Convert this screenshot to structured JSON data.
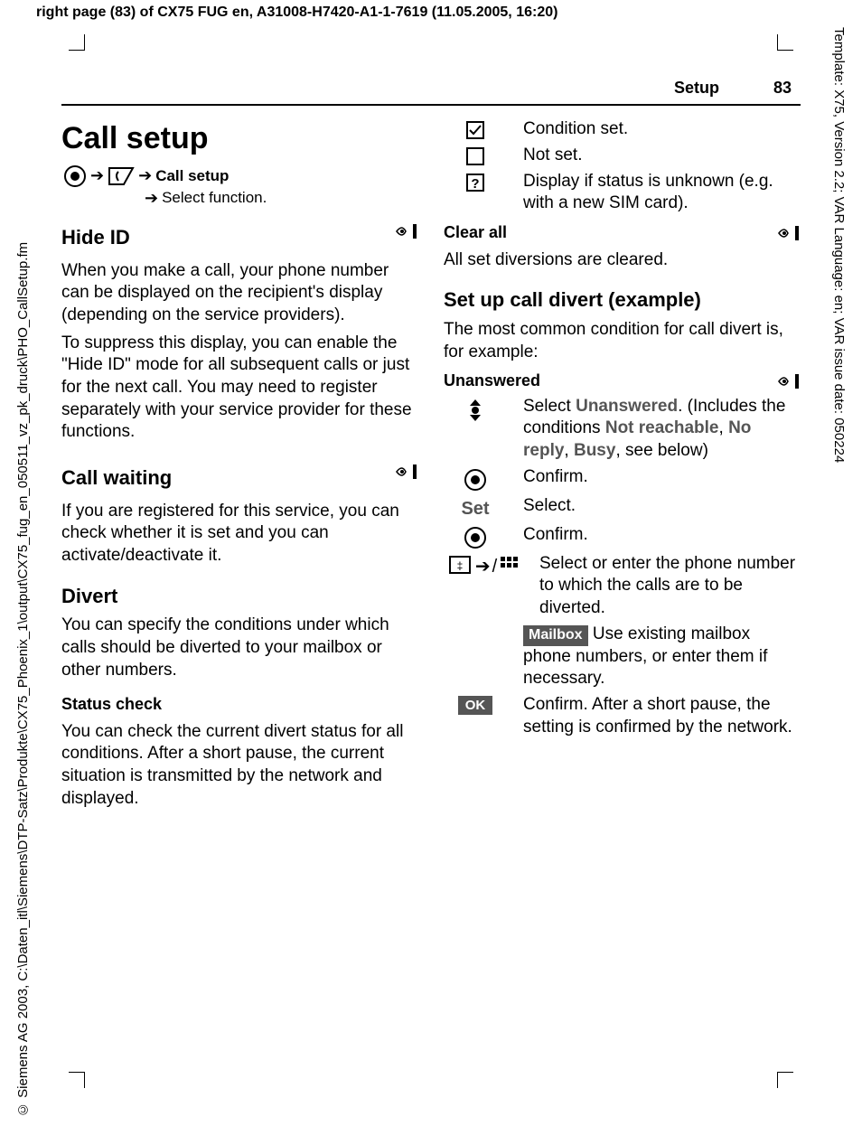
{
  "meta": {
    "top": "right page (83) of CX75 FUG en, A31008-H7420-A1-1-7619 (11.05.2005, 16:20)",
    "left": "© Siemens AG 2003, C:\\Daten_itl\\Siemens\\DTP-Satz\\Produkte\\CX75_Phoenix_1\\output\\CX75_fug_en_050511_vz_pk_druck\\PHO_CallSetup.fm",
    "right": "Template: X75, Version 2.2; VAR Language: en; VAR issue date: 050224"
  },
  "header": {
    "section": "Setup",
    "page": "83"
  },
  "left_col": {
    "title": "Call setup",
    "crumb1": "Call setup",
    "crumb2": "Select function.",
    "hide_id": {
      "h": "Hide ID",
      "p1": "When you make a call, your phone number can be displayed on the recipient's display (depending on the service providers).",
      "p2": "To suppress this display, you can enable the \"Hide ID\" mode for all subsequent calls or just for the next call. You may need to register separately with your service provider for these functions."
    },
    "call_waiting": {
      "h": "Call waiting",
      "p": "If you are registered for this service, you can check whether it is set and you can activate/deactivate it."
    },
    "divert": {
      "h": "Divert",
      "p": "You can specify the conditions under which calls should be diverted to your mailbox or other numbers.",
      "status_h": "Status check",
      "status_p": "You can check the current divert status for all conditions. After a short pause, the current situation is transmitted by the network and displayed."
    }
  },
  "right_col": {
    "legend": {
      "set": "Condition set.",
      "notset": "Not set.",
      "unknown": "Display if status is unknown (e.g. with a new SIM card)."
    },
    "clear_all": {
      "h": "Clear all",
      "p": "All set diversions are cleared."
    },
    "example": {
      "h": "Set up call divert (example)",
      "intro": "The most common condition for call divert is, for example:",
      "unanswered_h": "Unanswered",
      "step_select_pre": "Select ",
      "step_select_b": "Unanswered",
      "step_select_mid": ". (Includes the conditions ",
      "step_select_nr": "Not reachable",
      "step_select_c": ", ",
      "step_select_noreply": "No reply",
      "step_select_c2": ", ",
      "step_select_busy": "Busy",
      "step_select_tail": ", see below)",
      "confirm": "Confirm.",
      "set_lbl": "Set",
      "set_txt": "Select.",
      "confirm2": "Confirm.",
      "enter": "Select or enter the phone number to which the calls are to be diverted.",
      "mailbox_lbl": "Mailbox",
      "mailbox_txt": " Use existing mailbox phone numbers, or enter them if necessary.",
      "ok_lbl": "OK",
      "ok_txt": "Confirm. After a short pause, the setting is confirmed by the network."
    }
  }
}
